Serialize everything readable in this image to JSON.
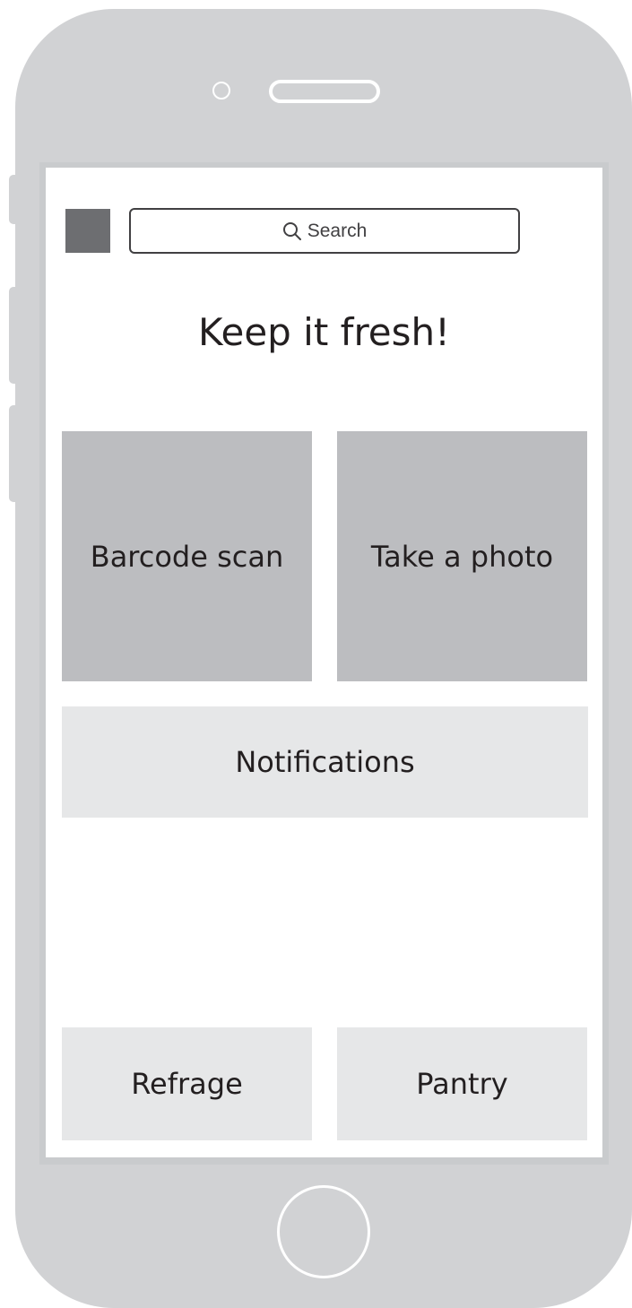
{
  "header": {
    "search_placeholder": "Search"
  },
  "main": {
    "title": "Keep it fresh!",
    "tiles": [
      {
        "label": "Barcode scan"
      },
      {
        "label": "Take a photo"
      }
    ],
    "notifications_label": "Notifications"
  },
  "bottom_nav": {
    "items": [
      {
        "label": "Refrage"
      },
      {
        "label": "Pantry"
      }
    ]
  },
  "icons": {
    "menu": "menu-icon",
    "search": "search-icon"
  },
  "colors": {
    "phone_body": "#d1d2d4",
    "menu_square": "#6d6e71",
    "tile_dark": "#bcbdc0",
    "tile_light": "#e6e7e8",
    "text": "#231f20"
  }
}
